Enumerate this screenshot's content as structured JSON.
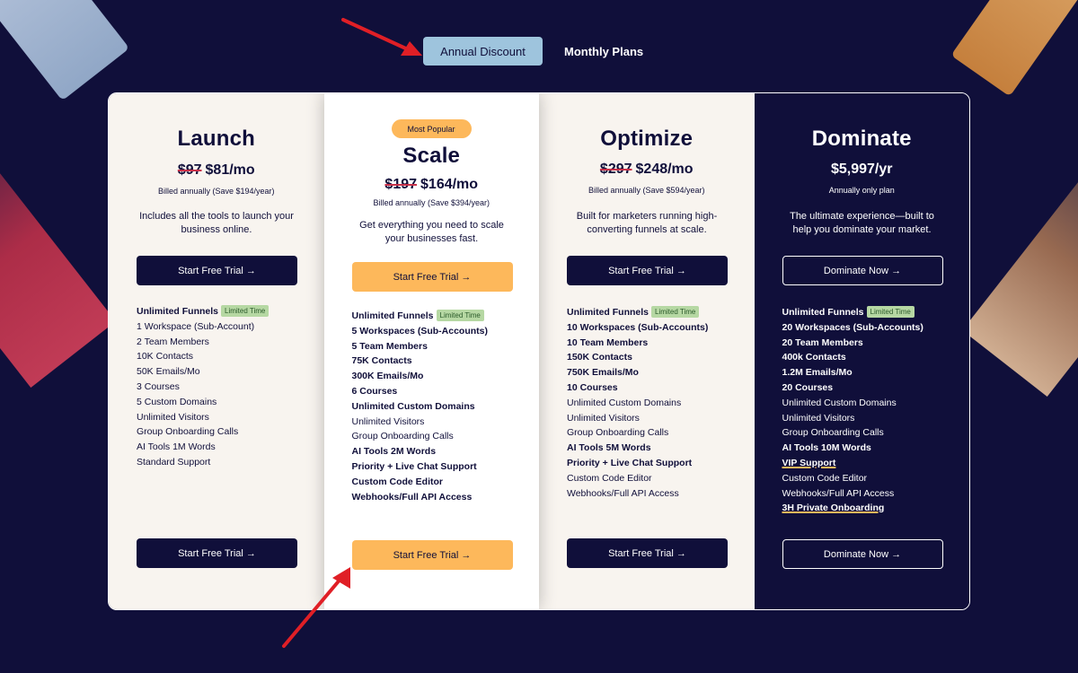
{
  "toggle": {
    "annual_label": "Annual Discount",
    "monthly_label": "Monthly Plans",
    "selected": "Annual Discount"
  },
  "colors": {
    "background": "#100f3a",
    "accent_gold": "#fdb85b",
    "toggle_active": "#9ec4dd",
    "badge_green": "#b6d8a3",
    "strike_red": "#c8324a"
  },
  "plans": [
    {
      "name": "Launch",
      "old_price": "$97",
      "price": "$81/mo",
      "billed": "Billed annually (Save $194/year)",
      "description": "Includes all the tools to launch your business online.",
      "cta_label": "Start Free Trial",
      "features": [
        {
          "text": "Unlimited Funnels",
          "badge": "Limited Time"
        },
        {
          "text": "1 Workspace (Sub-Account)"
        },
        {
          "text": "2 Team Members"
        },
        {
          "text": "10K Contacts"
        },
        {
          "text": "50K Emails/Mo"
        },
        {
          "text": "3 Courses"
        },
        {
          "text": "5 Custom Domains"
        },
        {
          "text": "Unlimited Visitors"
        },
        {
          "text": "Group Onboarding Calls"
        },
        {
          "text": "AI Tools 1M Words"
        },
        {
          "text": "Standard Support"
        }
      ]
    },
    {
      "name": "Scale",
      "tag": "Most Popular",
      "old_price": "$197",
      "price": "$164/mo",
      "billed": "Billed annually (Save $394/year)",
      "description": "Get everything you need to scale your businesses fast.",
      "cta_label": "Start Free Trial",
      "features": [
        {
          "text": "Unlimited Funnels",
          "badge": "Limited Time"
        },
        {
          "text": "5 Workspaces (Sub-Accounts)"
        },
        {
          "text": "5 Team Members"
        },
        {
          "text": "75K Contacts"
        },
        {
          "text": "300K Emails/Mo"
        },
        {
          "text": "6 Courses"
        },
        {
          "text": "Unlimited Custom Domains"
        },
        {
          "text": "Unlimited Visitors"
        },
        {
          "text": "Group Onboarding Calls"
        },
        {
          "text": "AI Tools 2M Words"
        },
        {
          "text": "Priority + Live Chat Support"
        },
        {
          "text": "Custom Code Editor"
        },
        {
          "text": "Webhooks/Full API Access"
        }
      ]
    },
    {
      "name": "Optimize",
      "old_price": "$297",
      "price": "$248/mo",
      "billed": "Billed annually (Save $594/year)",
      "description": "Built for marketers running high-converting funnels at scale.",
      "cta_label": "Start Free Trial",
      "features": [
        {
          "text": "Unlimited Funnels",
          "badge": "Limited Time"
        },
        {
          "text": "10 Workspaces (Sub-Accounts)"
        },
        {
          "text": "10 Team Members"
        },
        {
          "text": "150K Contacts"
        },
        {
          "text": "750K Emails/Mo"
        },
        {
          "text": "10 Courses"
        },
        {
          "text": "Unlimited Custom Domains"
        },
        {
          "text": "Unlimited Visitors"
        },
        {
          "text": "Group Onboarding Calls"
        },
        {
          "text": "AI Tools 5M Words"
        },
        {
          "text": "Priority + Live Chat Support"
        },
        {
          "text": "Custom Code Editor"
        },
        {
          "text": "Webhooks/Full API Access"
        }
      ]
    },
    {
      "name": "Dominate",
      "price": "$5,997/yr",
      "billed": "Annually only plan",
      "description": "The ultimate experience—built to help you dominate your market.",
      "cta_label": "Dominate Now",
      "features": [
        {
          "text": "Unlimited Funnels",
          "badge": "Limited Time"
        },
        {
          "text": "20 Workspaces (Sub-Accounts)"
        },
        {
          "text": "20 Team Members"
        },
        {
          "text": "400k Contacts"
        },
        {
          "text": "1.2M Emails/Mo"
        },
        {
          "text": "20 Courses"
        },
        {
          "text": "Unlimited Custom Domains"
        },
        {
          "text": "Unlimited Visitors"
        },
        {
          "text": "Group Onboarding Calls"
        },
        {
          "text": "AI Tools 10M Words"
        },
        {
          "text": "VIP Support"
        },
        {
          "text": "Custom Code Editor"
        },
        {
          "text": "Webhooks/Full API Access"
        },
        {
          "text": "3H Private Onboarding"
        }
      ]
    }
  ]
}
